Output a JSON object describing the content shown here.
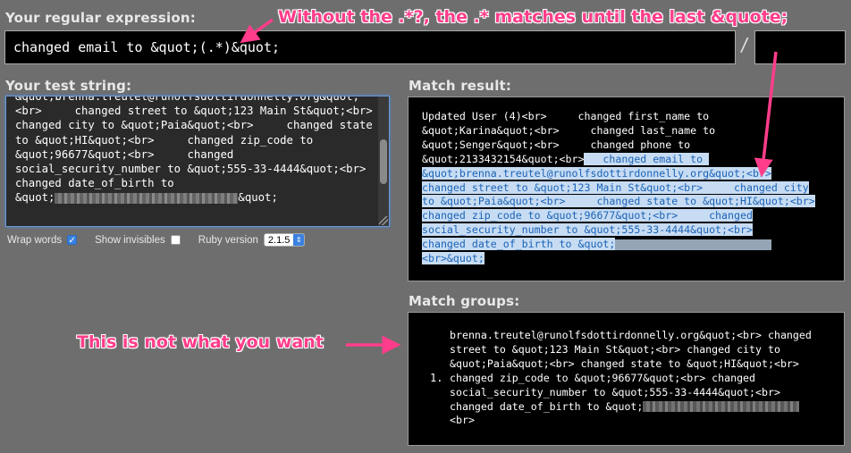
{
  "labels": {
    "regex": "Your regular expression:",
    "test_string": "Your test string:",
    "match_result": "Match result:",
    "match_groups": "Match groups:"
  },
  "regex": {
    "value": "changed email to &quot;(.*)&quot;",
    "delimiter": "/"
  },
  "test_string_lines": [
    "&quot;brenna.treutel@runolfsdottirdonnelly.org&quot;",
    "<br>     changed street to &quot;123 Main St&quot;<br>",
    "changed city to &quot;Paia&quot;<br>     changed state",
    "to &quot;HI&quot;<br>     changed zip_code to",
    "&quot;96677&quot;<br>     changed",
    "social_security_number to &quot;555-33-4444&quot;<br>",
    "changed date_of_birth to",
    "&quot;",
    "&quot;"
  ],
  "options": {
    "wrap_words": "Wrap words",
    "wrap_words_checked": true,
    "show_invisibles": "Show invisibles",
    "show_invisibles_checked": false,
    "ruby_version_label": "Ruby version",
    "ruby_version_value": "2.1.5"
  },
  "match_result": {
    "line1": "Updated User (4)<br>     changed first_name to",
    "line2": "&quot;Karina&quot;<br>     changed last_name to",
    "line3": "&quot;Senger&quot;<br>     changed phone to",
    "line4_plain": "&quot;2133432154&quot;<br>",
    "line4_hl": "   changed email to ",
    "hl_lines": [
      "&quot;brenna.treutel@runolfsdottirdonnelly.org&quot;<br>",
      "changed street to &quot;123 Main St&quot;<br>     changed city",
      "to &quot;Paia&quot;<br>     changed state to &quot;HI&quot;<br>",
      "changed zip_code to &quot;96677&quot;<br>     changed",
      "social_security_number to &quot;555-33-4444&quot;<br>",
      "changed date_of_birth to &quot;",
      "<br>&quot;"
    ]
  },
  "match_groups": {
    "number": "1.",
    "lines": [
      "brenna.treutel@runolfsdottirdonnelly.org&quot;<br> changed",
      "street to &quot;123 Main St&quot;<br> changed city to",
      "&quot;Paia&quot;<br> changed state to &quot;HI&quot;<br>",
      "changed zip_code to &quot;96677&quot;<br> changed",
      "social_security_number to &quot;555-33-4444&quot;<br>",
      "changed date_of_birth to &quot;",
      "<br>"
    ]
  },
  "annotations": {
    "top": "Without the .*?, the .* matches until the last &quote;",
    "bottom": "This is not what you want"
  },
  "colors": {
    "annotation": "#ff3d8a",
    "highlight_bg": "#c7dcf3",
    "highlight_text": "#1b63b6"
  }
}
